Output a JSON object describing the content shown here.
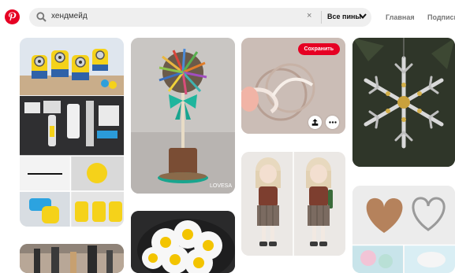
{
  "search": {
    "query": "хендмейд",
    "clear_symbol": "×",
    "scope_label": "Все пины"
  },
  "nav": {
    "home": "Главная",
    "following": "Подписки"
  },
  "pins": {
    "threads": {
      "save_label": "Сохранить"
    },
    "tree": {
      "watermark": "LOVESA"
    }
  },
  "colors": {
    "brand": "#e60023",
    "search_bg": "#efefef"
  }
}
